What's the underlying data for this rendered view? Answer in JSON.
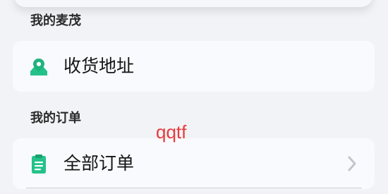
{
  "sections": {
    "my_maimao": {
      "title": "我的麦茂",
      "item_label": "收货地址",
      "icon": "location-pin-icon"
    },
    "my_orders": {
      "title": "我的订单",
      "item_label": "全部订单",
      "icon": "clipboard-list-icon"
    }
  },
  "watermark_text": "qqtf",
  "colors": {
    "accent": "#24c28a",
    "watermark": "#e63c3c",
    "background": "#f2f3f7",
    "card": "#f9fafe"
  }
}
